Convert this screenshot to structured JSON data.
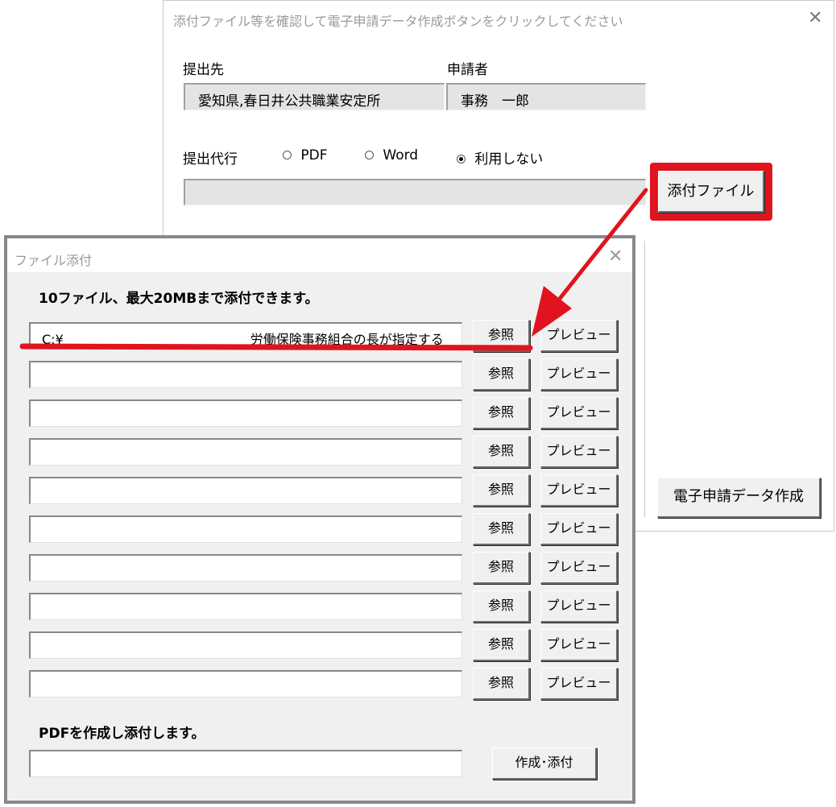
{
  "back_dialog": {
    "title": "添付ファイル等を確認して電子申請データ作成ボタンをクリックしてください",
    "submit_to_label": "提出先",
    "applicant_label": "申請者",
    "submit_to_value": "愛知県,春日井公共職業安定所",
    "applicant_value": "事務　一郎",
    "proxy_label": "提出代行",
    "radio_options": [
      {
        "label": "PDF",
        "selected": false
      },
      {
        "label": "Word",
        "selected": false
      },
      {
        "label": "利用しない",
        "selected": true
      }
    ],
    "attach_button": "添付ファイル",
    "create_button": "電子申請データ作成"
  },
  "front_dialog": {
    "title": "ファイル添付",
    "instruction": "10ファイル、最大20MBまで添付できます。",
    "files": [
      {
        "path_start": "C:¥",
        "path_end": "労働保険事務組合の長が指定する"
      },
      {
        "path_start": "",
        "path_end": ""
      },
      {
        "path_start": "",
        "path_end": ""
      },
      {
        "path_start": "",
        "path_end": ""
      },
      {
        "path_start": "",
        "path_end": ""
      },
      {
        "path_start": "",
        "path_end": ""
      },
      {
        "path_start": "",
        "path_end": ""
      },
      {
        "path_start": "",
        "path_end": ""
      },
      {
        "path_start": "",
        "path_end": ""
      },
      {
        "path_start": "",
        "path_end": ""
      }
    ],
    "browse_label": "参照",
    "preview_label": "プレビュー",
    "pdf_label": "PDFを作成し添付します。",
    "pdf_path": "",
    "create_attach_button": "作成･添付"
  },
  "colors": {
    "highlight_red": "#e0141e",
    "dialog_bg": "#f0f0f0",
    "field_bg": "#e4e4e4"
  },
  "icons": {
    "close": "close-icon",
    "annotation_arrow": "red-arrow-icon"
  }
}
